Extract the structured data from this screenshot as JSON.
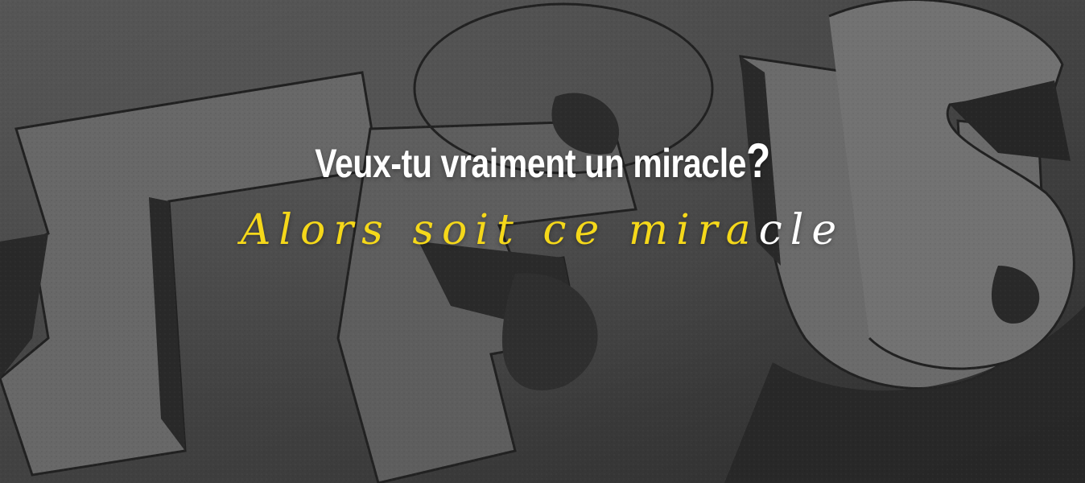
{
  "banner": {
    "headline": {
      "text": "Veux-tu vraiment un miracle",
      "punct": "?"
    },
    "tagline": {
      "yellow": "Alors soit ce mira",
      "white": "cle"
    },
    "background": {
      "graffiti_word": "JESUS"
    }
  },
  "colors": {
    "headline": "#ffffff",
    "tagline_accent": "#f5d81a",
    "background": "#555555"
  }
}
